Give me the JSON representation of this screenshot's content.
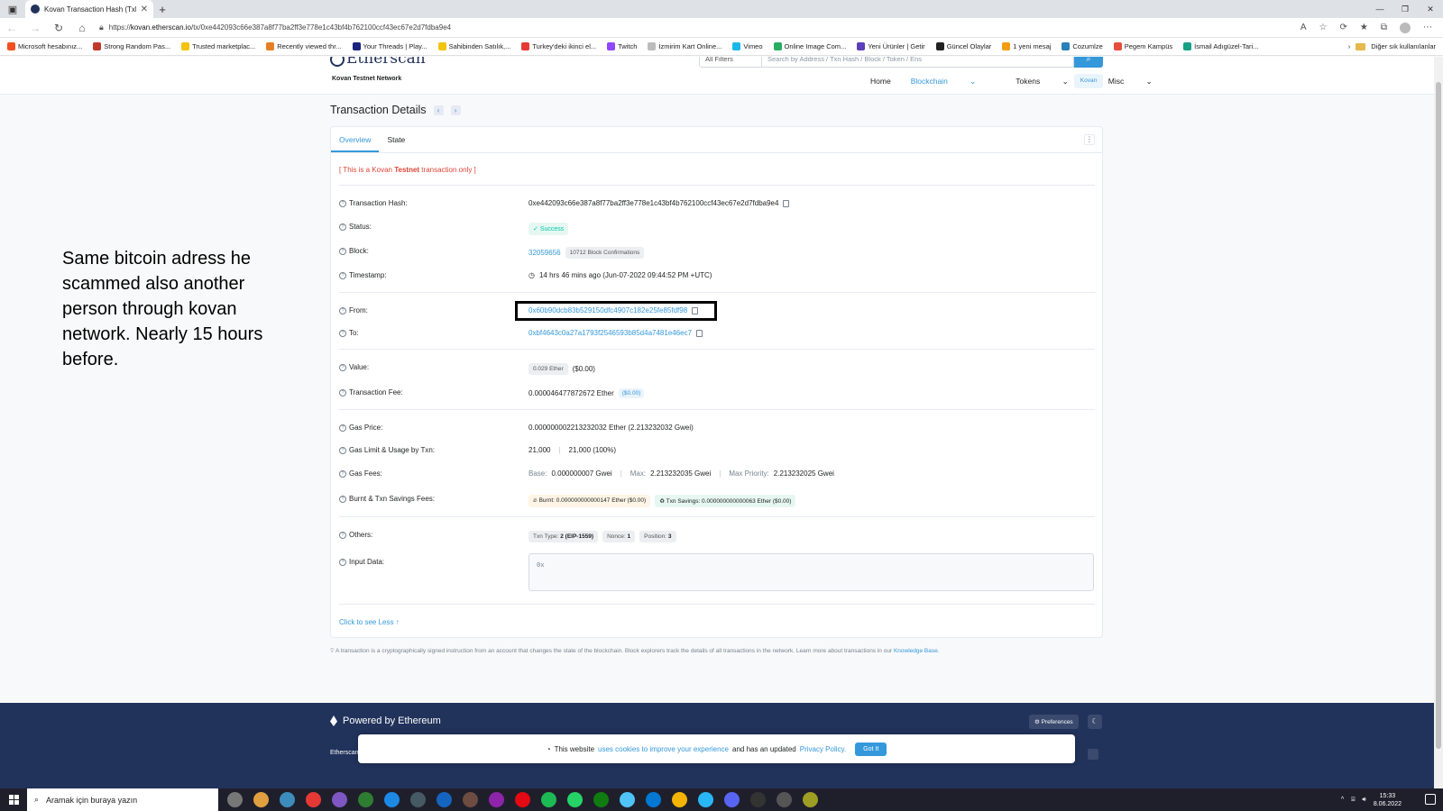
{
  "browser": {
    "tab_title": "Kovan Transaction Hash (Txhash...",
    "url_prefix": "https://",
    "url_domain": "kovan.etherscan.io",
    "url_path": "/tx/0xe442093c66e387a8f77ba2ff3e778e1c43bf4b762100ccf43ec67e2d7fdba9e4",
    "bookmarks": [
      {
        "label": "Microsoft hesabınız...",
        "color": "#f25022"
      },
      {
        "label": "Strong Random Pas...",
        "color": "#c0392b"
      },
      {
        "label": "Trusted marketplac...",
        "color": "#f1c40f"
      },
      {
        "label": "Recently viewed thr...",
        "color": "#e67e22"
      },
      {
        "label": "Your Threads | Play...",
        "color": "#1a237e"
      },
      {
        "label": "Sahibinden Satılık,...",
        "color": "#f1c40f"
      },
      {
        "label": "Turkey'deki ikinci el...",
        "color": "#e53935"
      },
      {
        "label": "Twitch",
        "color": "#9146ff"
      },
      {
        "label": "İzmirim Kart Online...",
        "color": "#bbbbbb"
      },
      {
        "label": "Vimeo",
        "color": "#1ab7ea"
      },
      {
        "label": "Online Image Com...",
        "color": "#27ae60"
      },
      {
        "label": "Yeni Ürünler | Getir",
        "color": "#5d3ebc"
      },
      {
        "label": "Güncel Olaylar",
        "color": "#222222"
      },
      {
        "label": "1 yeni mesaj",
        "color": "#f39c12"
      },
      {
        "label": "Cozumlze",
        "color": "#2980b9"
      },
      {
        "label": "Pegem Kampüs",
        "color": "#e74c3c"
      },
      {
        "label": "İsmail Adıgüzel-Tari...",
        "color": "#16a085"
      }
    ],
    "other_bookmarks": "Diğer sık kullanılanlar"
  },
  "site": {
    "logo": "Etherscan",
    "network": "Kovan Testnet Network",
    "filter_label": "All Filters",
    "search_placeholder": "Search by Address / Txn Hash / Block / Token / Ens",
    "nav": {
      "home": "Home",
      "blockchain": "Blockchain",
      "tokens": "Tokens",
      "misc": "Misc"
    },
    "network_badge": "Kovan"
  },
  "page_title": "Transaction Details",
  "tabs": {
    "overview": "Overview",
    "state": "State"
  },
  "testnet_note": {
    "pre": "[ This is a Kovan ",
    "bold": "Testnet",
    "post": " transaction only ]"
  },
  "tx": {
    "hash_label": "Transaction Hash:",
    "hash": "0xe442093c66e387a8f77ba2ff3e778e1c43bf4b762100ccf43ec67e2d7fdba9e4",
    "status_label": "Status:",
    "status": "Success",
    "block_label": "Block:",
    "block": "32059656",
    "confirmations": "10712 Block Confirmations",
    "timestamp_label": "Timestamp:",
    "timestamp": "14 hrs 46 mins ago (Jun-07-2022 09:44:52 PM +UTC)",
    "from_label": "From:",
    "from": "0x60b90dcb83b529150dfc4907c182e25fe85fdf98",
    "to_label": "To:",
    "to": "0xbf4643c0a27a1793f2546593b85d4a7481e46ec7",
    "value_label": "Value:",
    "value": "0.029 Ether",
    "value_usd": "($0.00)",
    "fee_label": "Transaction Fee:",
    "fee": "0.000046477872672 Ether",
    "fee_usd": "($0.00)",
    "gas_price_label": "Gas Price:",
    "gas_price": "0.000000002213232032 Ether (2.213232032 Gwei)",
    "gas_limit_label": "Gas Limit & Usage by Txn:",
    "gas_limit": "21,000",
    "gas_usage": "21,000 (100%)",
    "gas_fees_label": "Gas Fees:",
    "gas_base_label": "Base:",
    "gas_base": "0.000000007 Gwei",
    "gas_max_label": "Max:",
    "gas_max": "2.213232035 Gwei",
    "gas_maxprio_label": "Max Priority:",
    "gas_maxprio": "2.213232025 Gwei",
    "burnt_label": "Burnt & Txn Savings Fees:",
    "burnt": "Burnt: 0.000000000000147 Ether ($0.00)",
    "savings": "Txn Savings: 0.000000000000063 Ether ($0.00)",
    "others_label": "Others:",
    "txn_type_label": "Txn Type:",
    "txn_type": "2 (EIP-1559)",
    "nonce_label": "Nonce:",
    "nonce": "1",
    "position_label": "Position:",
    "position": "3",
    "input_label": "Input Data:",
    "input": "0x"
  },
  "see_less": "Click to see Less",
  "footnote": {
    "text": "A transaction is a cryptographically signed instruction from an account that changes the state of the blockchain. Block explorers track the details of all transactions in the network. Learn more about transactions in our ",
    "link": "Knowledge Base."
  },
  "footer": {
    "powered": "Powered by Ethereum",
    "preferences": "Preferences",
    "small": "Etherscan"
  },
  "cookie": {
    "pre": "This website",
    "link1": "uses cookies to improve your experience",
    "mid": "and has an updated",
    "link2": "Privacy Policy.",
    "button": "Got It"
  },
  "annotation": "Same bitcoin adress he scammed also another person through kovan network. Nearly 15 hours before.",
  "taskbar": {
    "search_placeholder": "Aramak için buraya yazın",
    "time": "15:33",
    "date": "8.06.2022",
    "app_colors": [
      "#777777",
      "#e0a040",
      "#3c8dbc",
      "#e53935",
      "#7e57c2",
      "#2e7d32",
      "#1e88e5",
      "#455a64",
      "#1565c0",
      "#6d4c41",
      "#8e24aa",
      "#e50914",
      "#1db954",
      "#25d366",
      "#107c10",
      "#4fc3f7",
      "#0078d4",
      "#f4b400",
      "#29b6f6",
      "#5865f2",
      "#333333",
      "#555555",
      "#9e9d24"
    ]
  },
  "colors": {
    "accent": "#3498db",
    "success": "#00c9a7",
    "danger": "#de4437",
    "footer": "#21325b"
  }
}
